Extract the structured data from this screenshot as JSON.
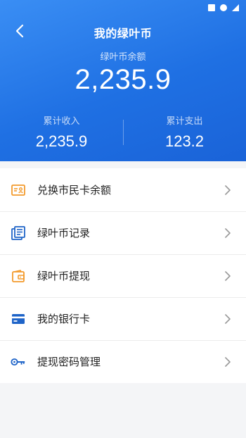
{
  "header": {
    "title": "我的绿叶币",
    "balance_label": "绿叶币余额",
    "balance_value": "2,235.9",
    "income_label": "累计收入",
    "income_value": "2,235.9",
    "expense_label": "累计支出",
    "expense_value": "123.2"
  },
  "menu": {
    "items": [
      {
        "label": "兑换市民卡余额",
        "icon": "id-card-icon"
      },
      {
        "label": "绿叶币记录",
        "icon": "document-list-icon"
      },
      {
        "label": "绿叶币提现",
        "icon": "wallet-icon"
      },
      {
        "label": "我的银行卡",
        "icon": "bank-card-icon"
      },
      {
        "label": "提现密码管理",
        "icon": "key-icon"
      }
    ]
  },
  "colors": {
    "header_blue": "#2a7ae9",
    "icon_orange": "#f39a2b",
    "icon_blue": "#1f64c8"
  }
}
